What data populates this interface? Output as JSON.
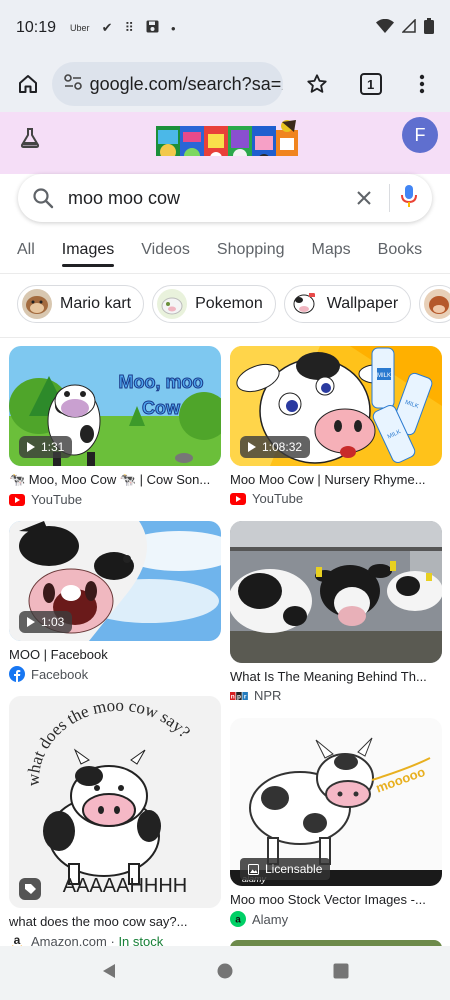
{
  "status_bar": {
    "time": "10:19",
    "app_label": "Uber"
  },
  "browser": {
    "url": "google.com/search?sa=X",
    "tab_count": "1"
  },
  "google": {
    "avatar_initial": "F",
    "search_query": "moo moo cow",
    "tabs": [
      {
        "label": "All",
        "active": false
      },
      {
        "label": "Images",
        "active": true
      },
      {
        "label": "Videos",
        "active": false
      },
      {
        "label": "Shopping",
        "active": false
      },
      {
        "label": "Maps",
        "active": false
      },
      {
        "label": "Books",
        "active": false
      }
    ],
    "chips": [
      {
        "label": "Mario kart"
      },
      {
        "label": "Pokemon"
      },
      {
        "label": "Wallpaper"
      }
    ]
  },
  "results": [
    {
      "title": "🐄 Moo, Moo Cow 🐄 | Cow Son...",
      "source": "YouTube",
      "duration": "1:31",
      "image_text": [
        "Moo, moo",
        "Cow"
      ]
    },
    {
      "title": "Moo Moo Cow | Nursery Rhyme...",
      "source": "YouTube",
      "duration": "1:08:32",
      "image_text": [
        "MILK",
        "MILK",
        "MILK"
      ]
    },
    {
      "title": "MOO | Facebook",
      "source": "Facebook",
      "duration": "1:03"
    },
    {
      "title": "What Is The Meaning Behind Th...",
      "source": "NPR",
      "source_logo": "NPR"
    },
    {
      "title": "what does the moo cow say?...",
      "source": "Amazon.com",
      "separator": " · ",
      "source_extra": "In stock",
      "image_text": [
        "what does the moo cow say?",
        "AAAAAHHHH"
      ]
    },
    {
      "title": "Moo moo Stock Vector Images -...",
      "source": "Alamy",
      "badge": "Licensable",
      "image_text": [
        "mooooo",
        "alamy"
      ]
    }
  ],
  "colors": {
    "header_bg": "#f5def7",
    "browser_bg": "#eceff4",
    "avatar": "#5f6fcf",
    "youtube_red": "#ff0000",
    "facebook_blue": "#1877f2",
    "alamy_green": "#00d066",
    "in_stock": "#188038"
  }
}
